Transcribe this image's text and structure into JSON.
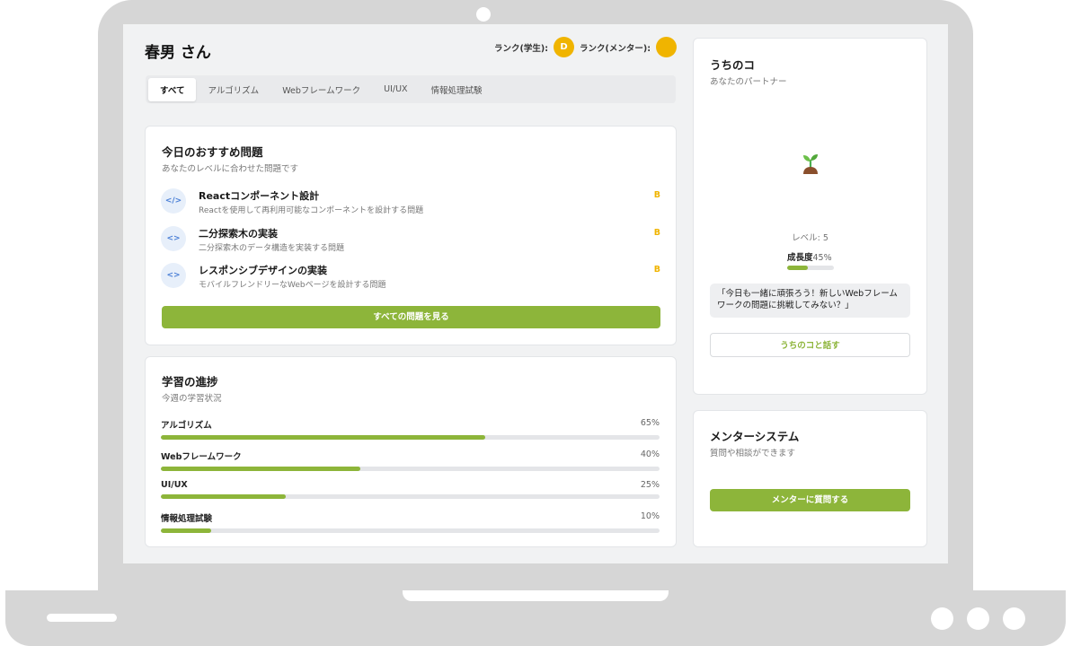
{
  "user": {
    "name": "春男 さん"
  },
  "ranks": [
    {
      "label": "ランク(学生):",
      "value": "D"
    },
    {
      "label": "ランク(メンター):",
      "value": ""
    }
  ],
  "tabs": [
    {
      "label": "すべて",
      "active": true
    },
    {
      "label": "アルゴリズム",
      "active": false
    },
    {
      "label": "Webフレームワーク",
      "active": false
    },
    {
      "label": "UI/UX",
      "active": false
    },
    {
      "label": "情報処理試験",
      "active": false
    }
  ],
  "recommended": {
    "title": "今日のおすすめ問題",
    "subtitle": "あなたのレベルに合わせた問題です",
    "items": [
      {
        "icon": "code-icon",
        "glyph": "</>",
        "title": "Reactコンポーネント設計",
        "desc": "Reactを使用して再利用可能なコンポーネントを設計する問題",
        "grade": "B"
      },
      {
        "icon": "code-brackets-icon",
        "glyph": "<>",
        "title": "二分探索木の実装",
        "desc": "二分探索木のデータ構造を実装する問題",
        "grade": "B"
      },
      {
        "icon": "code-brackets-icon",
        "glyph": "<>",
        "title": "レスポンシブデザインの実装",
        "desc": "モバイルフレンドリーなWebページを設計する問題",
        "grade": "B"
      }
    ],
    "button_label": "すべての問題を見る"
  },
  "progress": {
    "title": "学習の進捗",
    "subtitle": "今週の学習状況",
    "items": [
      {
        "label": "アルゴリズム",
        "percent": 65,
        "percent_text": "65%"
      },
      {
        "label": "Webフレームワーク",
        "percent": 40,
        "percent_text": "40%"
      },
      {
        "label": "UI/UX",
        "percent": 25,
        "percent_text": "25%"
      },
      {
        "label": "情報処理試験",
        "percent": 10,
        "percent_text": "10%"
      }
    ]
  },
  "partner": {
    "title": "うちのコ",
    "subtitle": "あなたのパートナー",
    "avatar_icon": "seedling-icon",
    "level_text": "レベル: 5",
    "growth_label": "成長度",
    "growth_text": "45%",
    "growth_percent": 45,
    "message": "「今日も一緒に頑張ろう！新しいWebフレームワークの問題に挑戦してみない？」",
    "button_label": "うちのコと話す"
  },
  "mentor": {
    "title": "メンターシステム",
    "subtitle": "質問や相談ができます",
    "button_label": "メンターに質問する"
  },
  "colors": {
    "accent": "#8db53a",
    "rank_badge": "#f0b400",
    "frame": "#d6d6d6",
    "screen_bg": "#f1f2f3"
  }
}
